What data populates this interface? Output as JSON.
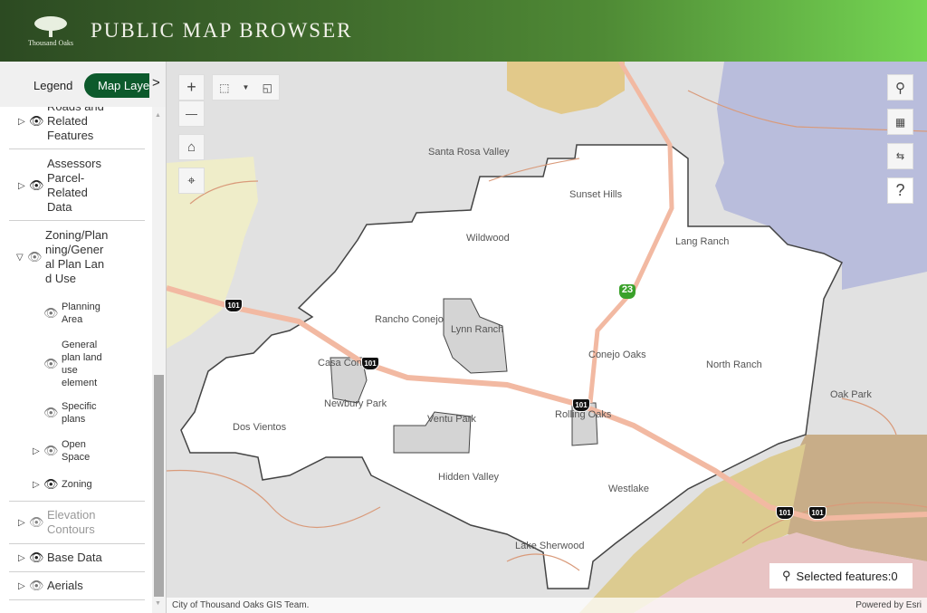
{
  "header": {
    "logo_text": "Thousand Oaks",
    "title": "PUBLIC MAP BROWSER"
  },
  "panel": {
    "tabs": {
      "legend": "Legend",
      "map_layers": "Map Layers",
      "next": ">"
    },
    "layers": [
      {
        "label": "Roads and Related Features",
        "expanded": false,
        "visible": true
      },
      {
        "label": "Assessors Parcel-Related Data",
        "expanded": false,
        "visible": true
      },
      {
        "label": "Zoning/Planning/General Plan Land Use",
        "expanded": true,
        "visible": false,
        "children": [
          {
            "label": "Planning Area",
            "visible": false
          },
          {
            "label": "General plan land use element",
            "visible": false
          },
          {
            "label": "Specific plans",
            "visible": false
          },
          {
            "label": "Open Space",
            "visible": false,
            "expandable": true
          },
          {
            "label": "Zoning",
            "visible": true,
            "expandable": true
          }
        ]
      },
      {
        "label": "Elevation Contours",
        "expanded": false,
        "visible": false,
        "dimmed": true
      },
      {
        "label": "Base Data",
        "expanded": false,
        "visible": true
      },
      {
        "label": "Aerials",
        "expanded": false,
        "visible": false
      }
    ]
  },
  "map": {
    "places": [
      "Santa Rosa Valley",
      "Sunset Hills",
      "Wildwood",
      "Lang Ranch",
      "Rancho Conejo",
      "Lynn Ranch",
      "Conejo Oaks",
      "North Ranch",
      "Casa Conejo",
      "Newbury Park",
      "Dos Vientos",
      "Ventu Park",
      "Rolling Oaks",
      "Oak Park",
      "Hidden Valley",
      "Westlake",
      "Lake Sherwood"
    ],
    "shields": {
      "us101": "101",
      "sr23": "23"
    },
    "tools": {
      "zoom_in": "+",
      "zoom_out": "—",
      "help": "?"
    },
    "selected_features": "Selected features:0",
    "attribution": "City of Thousand Oaks GIS Team.",
    "powered_by": "Powered by Esri",
    "colors": {
      "city": "#ffffff",
      "outside": "#e1e1e1",
      "purple": "#b9bddc",
      "tan": "#e2c98a",
      "yellow": "#efedc9",
      "brown": "#c8ad88",
      "pink": "#e8c4c4",
      "highway": "#f2b9a2",
      "road": "#d99a7a"
    }
  }
}
